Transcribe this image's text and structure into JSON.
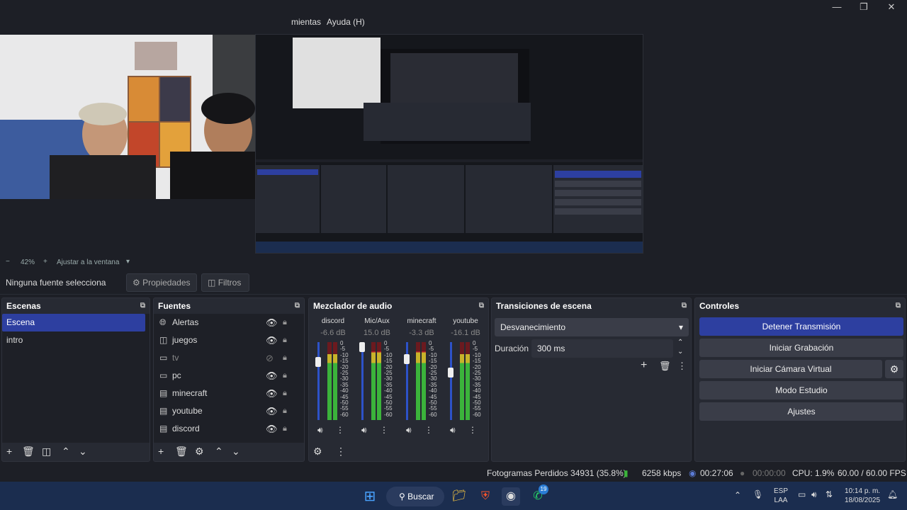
{
  "menu": {
    "tools_partial": "mientas",
    "help": "Ayuda (H)"
  },
  "zoom": {
    "level": "42%",
    "fit": "Ajustar a la ventana"
  },
  "source_bar": {
    "none_selected": "Ninguna fuente selecciona",
    "properties": "Propiedades",
    "filters": "Filtros"
  },
  "scenes": {
    "title": "Escenas",
    "items": [
      {
        "label": "Escena",
        "selected": true
      },
      {
        "label": "intro",
        "selected": false
      }
    ]
  },
  "sources": {
    "title": "Fuentes",
    "items": [
      {
        "label": "Alertas",
        "icon": "globe-icon",
        "visible": true
      },
      {
        "label": "juegos",
        "icon": "gamepad-icon",
        "visible": true
      },
      {
        "label": "tv",
        "icon": "monitor-icon",
        "visible": false
      },
      {
        "label": "pc",
        "icon": "monitor-icon",
        "visible": true
      },
      {
        "label": "minecraft",
        "icon": "window-icon",
        "visible": true
      },
      {
        "label": "youtube",
        "icon": "window-icon",
        "visible": true
      },
      {
        "label": "discord",
        "icon": "window-icon",
        "visible": true
      }
    ]
  },
  "mixer": {
    "title": "Mezclador de audio",
    "scale": [
      "0",
      "-5",
      "-10",
      "-15",
      "-20",
      "-25",
      "-30",
      "-35",
      "-40",
      "-45",
      "-50",
      "-55",
      "-60"
    ],
    "channels": [
      {
        "name": "discord",
        "db": "-6.6 dB",
        "volume": 0.78,
        "level": 0.15
      },
      {
        "name": "Mic/Aux",
        "db": "15.0 dB",
        "volume": 1.0,
        "level": 0.12
      },
      {
        "name": "minecraft",
        "db": "-3.3 dB",
        "volume": 0.82,
        "level": 0.12
      },
      {
        "name": "youtube",
        "db": "-16.1 dB",
        "volume": 0.62,
        "level": 0.15
      }
    ]
  },
  "transitions": {
    "title": "Transiciones de escena",
    "selected": "Desvanecimiento",
    "duration_label": "Duración",
    "duration_value": "300 ms"
  },
  "controls": {
    "title": "Controles",
    "buttons": [
      "Detener Transmisión",
      "Iniciar Grabación",
      "Iniciar Cámara Virtual",
      "Modo Estudio",
      "Ajustes"
    ]
  },
  "status": {
    "dropped": "Fotogramas Perdidos 34931 (35.8%)",
    "bitrate": "6258 kbps",
    "stream_time": "00:27:06",
    "rec_time": "00:00:00",
    "cpu": "CPU: 1.9%",
    "fps": "60.00 / 60.00 FPS"
  },
  "taskbar": {
    "search": "Buscar",
    "whatsapp_badge": "19",
    "lang": "ESP",
    "lang2": "LAA",
    "time": "10:14 p. m.",
    "date": "18/08/2025"
  },
  "colors": {
    "accent": "#2d3fa0",
    "panel": "#272a33",
    "bg": "#1d1f26",
    "taskbar": "#1b2d4f"
  }
}
